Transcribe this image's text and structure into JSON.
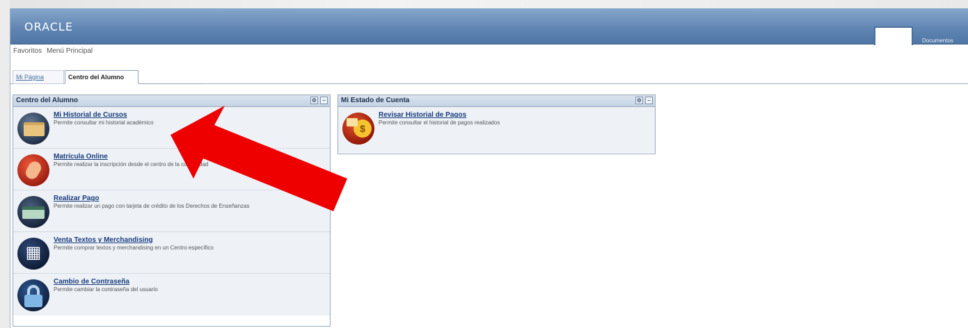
{
  "header": {
    "logo": "ORACLE",
    "right_link": "Documentos"
  },
  "menu": {
    "favoritos": "Favoritos",
    "menu_principal": "Menú Principal"
  },
  "tabs": [
    {
      "label": "Mi Página",
      "active": false
    },
    {
      "label": "Centro del Alumno",
      "active": true
    }
  ],
  "pagelets": {
    "centro": {
      "title": "Centro del Alumno",
      "items": [
        {
          "title": "Mi Historial de Cursos",
          "desc": "Permite consultar mi historial académico",
          "icon": "folder-icon"
        },
        {
          "title": "Matrícula Online",
          "desc": "Permite realizar la inscripción desde el centro de la comunidad",
          "icon": "mouse-icon"
        },
        {
          "title": "Realizar Pago",
          "desc": "Permite realizar un pago con tarjeta de crédito de los Derechos de Enseñanzas",
          "icon": "credit-card-icon"
        },
        {
          "title": "Venta Textos y Merchandising",
          "desc": "Permite comprar textos y merchandising en un Centro específico",
          "icon": "shopping-cart-icon"
        },
        {
          "title": "Cambio de Contraseña",
          "desc": "Permite cambiar la contraseña del usuario",
          "icon": "lock-icon"
        }
      ]
    },
    "estado": {
      "title": "Mi Estado de Cuenta",
      "items": [
        {
          "title": "Revisar Historial de Pagos",
          "desc": "Permite consultar el historial de pagos realizados",
          "icon": "money-icon"
        }
      ]
    }
  },
  "colors": {
    "header": "#5f84b1",
    "link": "#173a7a",
    "arrow": "#ee0000"
  }
}
